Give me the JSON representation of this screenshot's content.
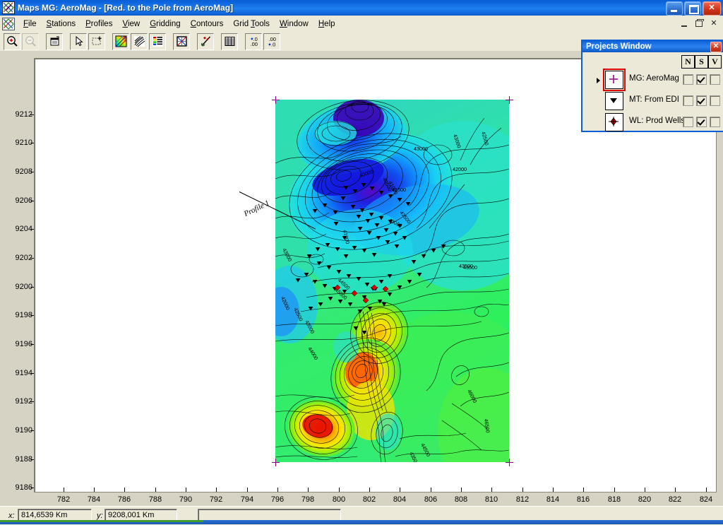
{
  "window": {
    "app_name": "Maps",
    "title": "Maps  MG: AeroMag - [Red. to the Pole from AeroMag]",
    "icon": "maps-app-icon",
    "buttons": {
      "minimize": "minimize-button",
      "maximize": "restore-button",
      "close": "close-button"
    }
  },
  "menu": {
    "document_icon": "maps-document-icon",
    "items": [
      {
        "label": "File",
        "accel": "F"
      },
      {
        "label": "Stations",
        "accel": "S"
      },
      {
        "label": "Profiles",
        "accel": "P"
      },
      {
        "label": "View",
        "accel": "V"
      },
      {
        "label": "Gridding",
        "accel": "G"
      },
      {
        "label": "Contours",
        "accel": "C"
      },
      {
        "label": "Grid Tools",
        "accel": "T"
      },
      {
        "label": "Window",
        "accel": "W"
      },
      {
        "label": "Help",
        "accel": "H"
      }
    ],
    "mdi_buttons": [
      "mdi-minimize",
      "mdi-restore",
      "mdi-close"
    ]
  },
  "toolbar": {
    "buttons": [
      {
        "name": "zoom-in-icon",
        "enabled": true
      },
      {
        "name": "zoom-out-icon",
        "enabled": false
      },
      {
        "name": "print-preview-icon",
        "enabled": true
      },
      {
        "name": "pointer-select-icon",
        "enabled": true
      },
      {
        "name": "rubber-band-zoom-icon",
        "enabled": true
      },
      {
        "name": "color-fill-icon",
        "enabled": true
      },
      {
        "name": "contour-lines-icon",
        "enabled": true
      },
      {
        "name": "color-legend-icon",
        "enabled": true
      },
      {
        "name": "grid-image-icon",
        "enabled": true
      },
      {
        "name": "profile-tool-icon",
        "enabled": true
      },
      {
        "name": "data-table-icon",
        "enabled": true
      },
      {
        "name": "increase-decimals-icon",
        "enabled": true
      },
      {
        "name": "decrease-decimals-icon",
        "enabled": true
      }
    ]
  },
  "projects_window": {
    "title": "Projects Window",
    "close_label": "✕",
    "column_headers": [
      "N",
      "S",
      "V"
    ],
    "rows": [
      {
        "symbol": "plus-marker",
        "label": "MG: AeroMag",
        "selected": true,
        "current": true,
        "n": false,
        "s": true,
        "v": false
      },
      {
        "symbol": "triangle-marker",
        "label": "MT: From EDI",
        "selected": false,
        "current": false,
        "n": false,
        "s": true,
        "v": false
      },
      {
        "symbol": "well-marker",
        "label": "WL: Prod Wells",
        "selected": false,
        "current": false,
        "n": false,
        "s": true,
        "v": false
      }
    ]
  },
  "status_bar": {
    "x_label": "x:",
    "x_value": "814,6539 Km",
    "y_label": "y:",
    "y_value": "9208,001 Km",
    "message": ""
  },
  "map": {
    "profile_label": "Profile 1",
    "contour_labels": [
      "43000",
      "42000",
      "43000",
      "42500",
      "41500",
      "42500",
      "40000",
      "40500",
      "41000",
      "43000",
      "43500",
      "42000",
      "42500",
      "44000",
      "44500",
      "43500",
      "44000",
      "45000",
      "43500",
      "44500",
      "45000",
      "46000",
      "46500",
      "43500"
    ],
    "corner_markers": 4
  },
  "chart_data": {
    "type": "heatmap",
    "title": "Red. to the Pole from AeroMag",
    "xlabel": "",
    "ylabel": "",
    "x_unit": "Km",
    "y_unit": "Km",
    "xlim": [
      780.6,
      825.2
    ],
    "ylim": [
      9185.0,
      9212.9
    ],
    "x_ticks": [
      782,
      784,
      786,
      788,
      790,
      792,
      794,
      796,
      798,
      800,
      802,
      804,
      806,
      808,
      810,
      812,
      814,
      816,
      818,
      820,
      822,
      824
    ],
    "y_ticks": [
      9212,
      9210,
      9208,
      9206,
      9204,
      9202,
      9200,
      9198,
      9196,
      9194,
      9192,
      9190,
      9188,
      9186
    ],
    "grid": false,
    "legend": "none",
    "data_extent": {
      "x": [
        795.0,
        809.0
      ],
      "y": [
        9189.2,
        9210.0
      ]
    },
    "value_range": [
      40000,
      46500
    ],
    "contour_interval": 500,
    "colormap": [
      "#7800c8",
      "#2020e0",
      "#1050f0",
      "#1090ff",
      "#10c8f0",
      "#20e8d0",
      "#30f0a0",
      "#40f060",
      "#80f030",
      "#c0f020",
      "#f0e010",
      "#ffb000",
      "#ff6000",
      "#e01000"
    ]
  }
}
